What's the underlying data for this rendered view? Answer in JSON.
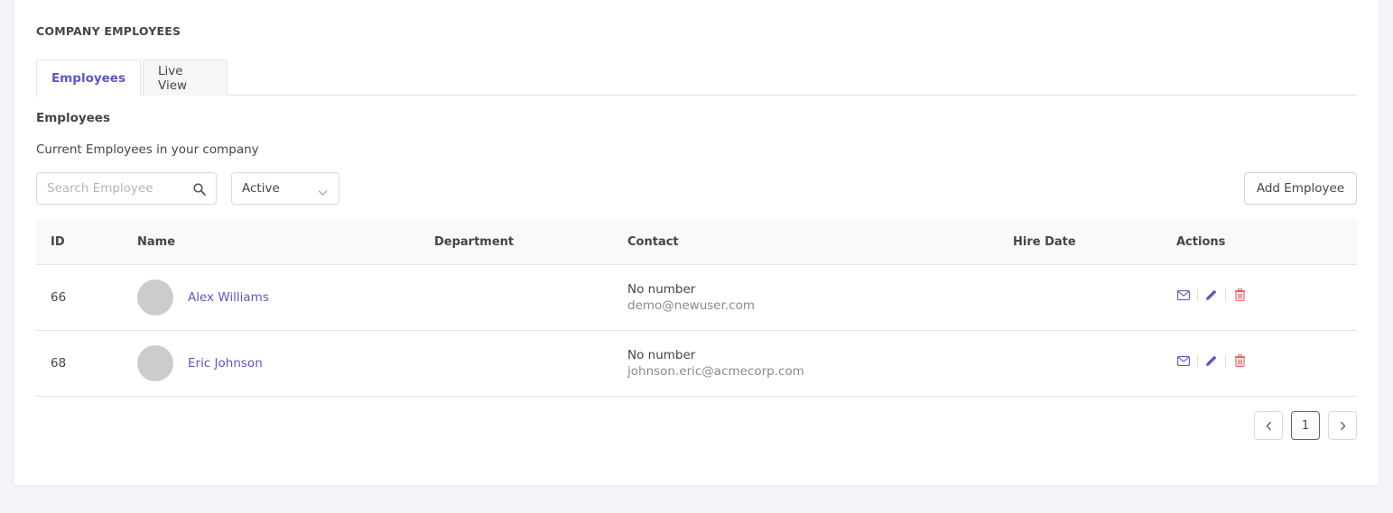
{
  "header": {
    "title": "COMPANY EMPLOYEES"
  },
  "tabs": [
    {
      "label": "Employees",
      "active": true
    },
    {
      "label": "Live View",
      "active": false
    }
  ],
  "section": {
    "title": "Employees",
    "subtitle": "Current Employees in your company"
  },
  "search": {
    "placeholder": "Search Employee",
    "value": ""
  },
  "status_filter": {
    "selected": "Active"
  },
  "add_button": {
    "label": "Add Employee"
  },
  "table": {
    "columns": [
      "ID",
      "Name",
      "Department",
      "Contact",
      "Hire Date",
      "Actions"
    ],
    "rows": [
      {
        "id": "66",
        "name": "Alex Williams",
        "department": "",
        "phone": "No number",
        "email": "demo@newuser.com",
        "hire_date": ""
      },
      {
        "id": "68",
        "name": "Eric Johnson",
        "department": "",
        "phone": "No number",
        "email": "johnson.eric@acmecorp.com",
        "hire_date": ""
      }
    ],
    "row_actions": [
      "mail-icon",
      "edit-pencil-icon",
      "trash-icon"
    ]
  },
  "pagination": {
    "current_page": "1"
  },
  "colors": {
    "accent": "#5a57c8",
    "danger": "#e05a5a",
    "text": "#454545",
    "muted": "#8a8a90",
    "avatar": "#cccccc"
  }
}
